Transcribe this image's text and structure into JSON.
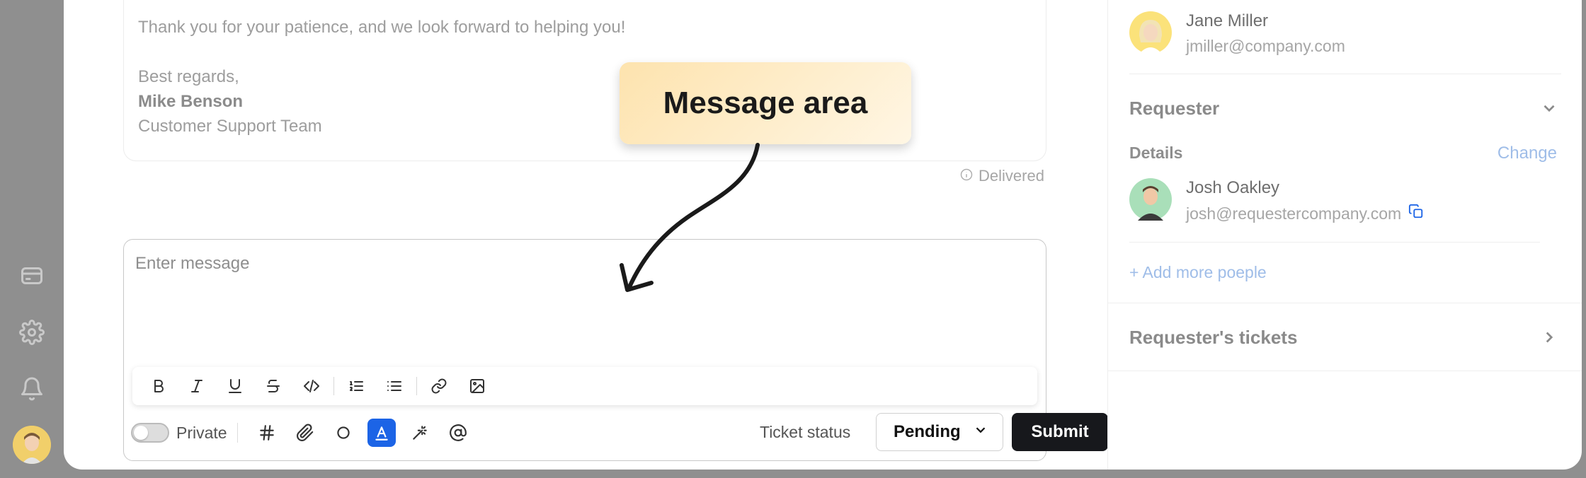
{
  "previous_message": {
    "line1": "Thank you for your patience, and we look forward to helping you!",
    "line2": "Best regards,",
    "signature_name": "Mike Benson",
    "signature_team": "Customer Support Team",
    "delivered_status": "Delivered"
  },
  "composer": {
    "placeholder": "Enter message",
    "toolbar_icons": [
      "bold-icon",
      "italic-icon",
      "underline-icon",
      "strikethrough-icon",
      "code-icon",
      "ordered-list-icon",
      "bullet-list-icon",
      "link-icon",
      "image-icon"
    ],
    "private_label": "Private",
    "action_icons": [
      "hashtag-icon",
      "paperclip-icon",
      "circle-icon",
      "text-color-icon",
      "magic-wand-icon",
      "mention-icon"
    ],
    "ticket_status_label": "Ticket status",
    "ticket_status_value": "Pending",
    "submit_label": "Submit",
    "accent_color": "#1c64e6"
  },
  "right_panel": {
    "assignee": {
      "name": "Jane Miller",
      "email": "jmiller@company.com"
    },
    "requester_section": {
      "title": "Requester",
      "details_label": "Details",
      "change_label": "Change",
      "person": {
        "name": "Josh Oakley",
        "email": "josh@requestercompany.com"
      },
      "add_more_label": "+ Add more poeple"
    },
    "requester_tickets_title": "Requester's tickets"
  },
  "annotation": {
    "label": "Message area"
  },
  "left_rail": {
    "icons": [
      "card-icon",
      "gear-icon",
      "bell-icon"
    ]
  }
}
